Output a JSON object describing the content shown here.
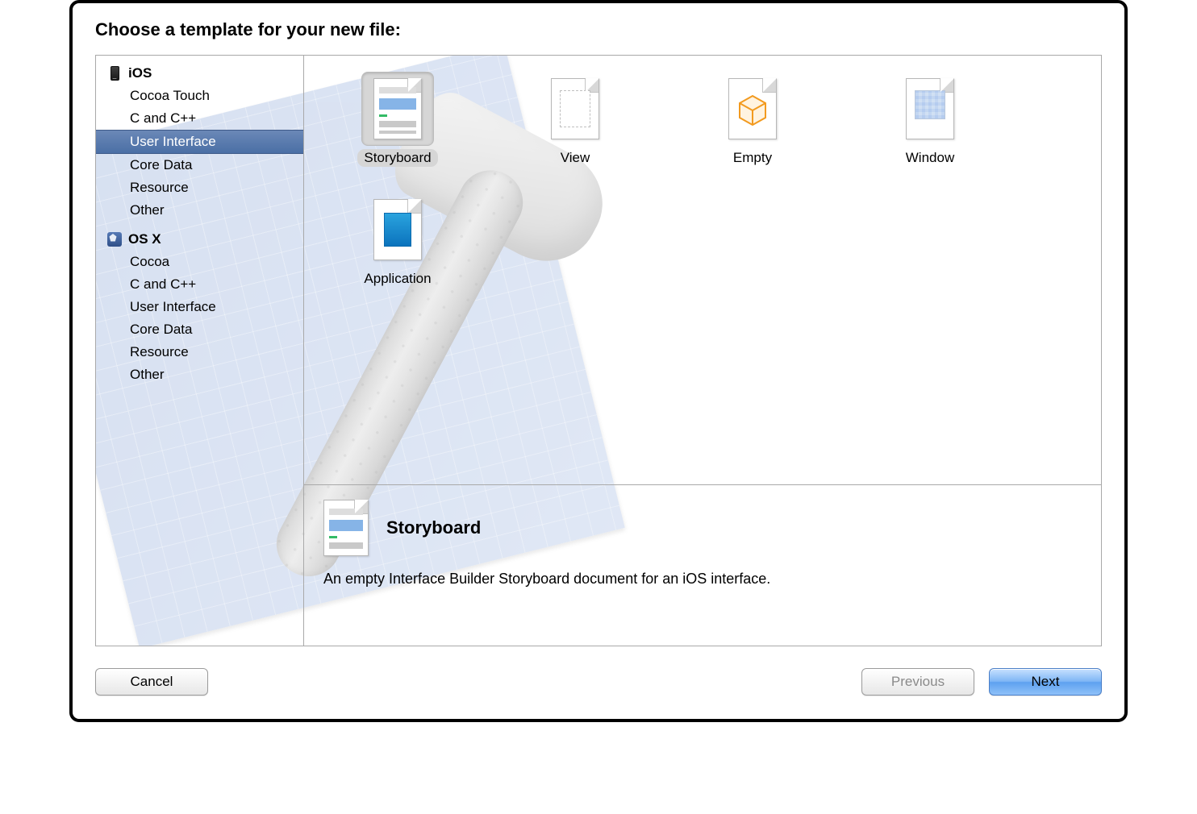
{
  "header": {
    "title": "Choose a template for your new file:"
  },
  "sidebar": {
    "groups": [
      {
        "name": "iOS",
        "icon": "ios-icon",
        "items": [
          {
            "label": "Cocoa Touch",
            "selected": false
          },
          {
            "label": "C and C++",
            "selected": false
          },
          {
            "label": "User Interface",
            "selected": true
          },
          {
            "label": "Core Data",
            "selected": false
          },
          {
            "label": "Resource",
            "selected": false
          },
          {
            "label": "Other",
            "selected": false
          }
        ]
      },
      {
        "name": "OS X",
        "icon": "osx-icon",
        "items": [
          {
            "label": "Cocoa",
            "selected": false
          },
          {
            "label": "C and C++",
            "selected": false
          },
          {
            "label": "User Interface",
            "selected": false
          },
          {
            "label": "Core Data",
            "selected": false
          },
          {
            "label": "Resource",
            "selected": false
          },
          {
            "label": "Other",
            "selected": false
          }
        ]
      }
    ]
  },
  "templates": [
    {
      "label": "Storyboard",
      "icon": "storyboard-icon",
      "selected": true
    },
    {
      "label": "View",
      "icon": "view-icon",
      "selected": false
    },
    {
      "label": "Empty",
      "icon": "empty-icon",
      "selected": false
    },
    {
      "label": "Window",
      "icon": "window-icon",
      "selected": false
    },
    {
      "label": "Application",
      "icon": "application-icon",
      "selected": false
    }
  ],
  "detail": {
    "title": "Storyboard",
    "description": "An empty Interface Builder Storyboard document for an iOS interface."
  },
  "buttons": {
    "cancel": "Cancel",
    "previous": "Previous",
    "next": "Next"
  }
}
